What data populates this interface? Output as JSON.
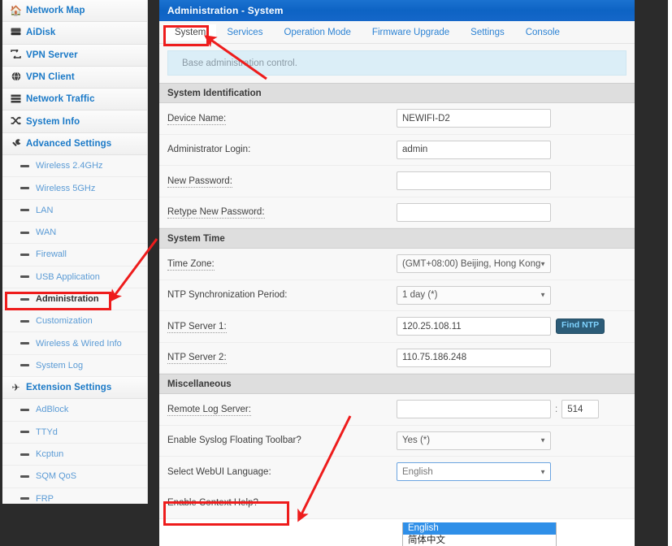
{
  "sidebar": {
    "items": [
      {
        "label": "Network Map",
        "icon": "home-icon",
        "type": "top"
      },
      {
        "label": "AiDisk",
        "icon": "hard-drive-icon",
        "type": "top"
      },
      {
        "label": "VPN Server",
        "icon": "exchange-icon",
        "type": "top"
      },
      {
        "label": "VPN Client",
        "icon": "globe-icon",
        "type": "top"
      },
      {
        "label": "Network Traffic",
        "icon": "server-icon",
        "type": "top"
      },
      {
        "label": "System Info",
        "icon": "shuffle-icon",
        "type": "top"
      },
      {
        "label": "Advanced Settings",
        "icon": "wrench-icon",
        "type": "top"
      },
      {
        "label": "Wireless 2.4GHz",
        "icon": "dash-icon",
        "type": "sub"
      },
      {
        "label": "Wireless 5GHz",
        "icon": "dash-icon",
        "type": "sub"
      },
      {
        "label": "LAN",
        "icon": "dash-icon",
        "type": "sub"
      },
      {
        "label": "WAN",
        "icon": "dash-icon",
        "type": "sub"
      },
      {
        "label": "Firewall",
        "icon": "dash-icon",
        "type": "sub"
      },
      {
        "label": "USB Application",
        "icon": "dash-icon",
        "type": "sub"
      },
      {
        "label": "Administration",
        "icon": "dash-icon",
        "type": "sub",
        "selected": true
      },
      {
        "label": "Customization",
        "icon": "dash-icon",
        "type": "sub"
      },
      {
        "label": "Wireless & Wired Info",
        "icon": "dash-icon",
        "type": "sub"
      },
      {
        "label": "System Log",
        "icon": "dash-icon",
        "type": "sub"
      },
      {
        "label": "Extension Settings",
        "icon": "plane-icon",
        "type": "top"
      },
      {
        "label": "AdBlock",
        "icon": "dash-icon",
        "type": "sub"
      },
      {
        "label": "TTYd",
        "icon": "dash-icon",
        "type": "sub"
      },
      {
        "label": "Kcptun",
        "icon": "dash-icon",
        "type": "sub"
      },
      {
        "label": "SQM QoS",
        "icon": "dash-icon",
        "type": "sub"
      },
      {
        "label": "FRP",
        "icon": "dash-icon",
        "type": "sub"
      }
    ]
  },
  "header": {
    "title": "Administration - System"
  },
  "tabs": [
    {
      "label": "System",
      "active": true
    },
    {
      "label": "Services",
      "active": false
    },
    {
      "label": "Operation Mode",
      "active": false
    },
    {
      "label": "Firmware Upgrade",
      "active": false
    },
    {
      "label": "Settings",
      "active": false
    },
    {
      "label": "Console",
      "active": false
    }
  ],
  "infobar": {
    "text": "Base administration control."
  },
  "sections": {
    "system_identification": {
      "title": "System Identification",
      "rows": {
        "device_name": {
          "label": "Device Name:",
          "value": "NEWIFI-D2"
        },
        "admin_login": {
          "label": "Administrator Login:",
          "value": "admin"
        },
        "new_password": {
          "label": "New Password:",
          "value": ""
        },
        "retype_password": {
          "label": "Retype New Password:",
          "value": ""
        }
      }
    },
    "system_time": {
      "title": "System Time",
      "rows": {
        "time_zone": {
          "label": "Time Zone:",
          "value": "(GMT+08:00) Beijing, Hong Kong"
        },
        "ntp_period": {
          "label": "NTP Synchronization Period:",
          "value": "1 day (*)"
        },
        "ntp_server1": {
          "label": "NTP Server 1:",
          "value": "120.25.108.11",
          "button": "Find NTP"
        },
        "ntp_server2": {
          "label": "NTP Server 2:",
          "value": "110.75.186.248"
        }
      }
    },
    "miscellaneous": {
      "title": "Miscellaneous",
      "rows": {
        "remote_log": {
          "label": "Remote Log Server:",
          "value": "",
          "separator": ":",
          "port": "514"
        },
        "syslog_toolbar": {
          "label": "Enable Syslog Floating Toolbar?",
          "value": "Yes (*)"
        },
        "webui_language": {
          "label": "Select WebUI Language:",
          "value": "English",
          "options": [
            {
              "label": "English",
              "selected": true
            },
            {
              "label": "简体中文",
              "selected": false
            }
          ]
        },
        "context_help": {
          "label": "Enable Context Help?"
        }
      }
    }
  },
  "colors": {
    "titlebar_blue": "#0d63c4",
    "link_blue": "#2d83d4",
    "sub_link_blue": "#5b9bd5",
    "annotation_red": "#ee1c1c",
    "dropdown_highlight": "#2f8fe8",
    "infobar_bg": "#dbeef7",
    "section_bg": "#dedede",
    "findntp_bg": "#2c5c78",
    "findntp_text": "#7fd3ff"
  },
  "annotations": {
    "boxes": [
      {
        "name": "administration-highlight"
      },
      {
        "name": "system-tab-highlight"
      },
      {
        "name": "webui-language-highlight"
      }
    ],
    "arrows": [
      {
        "name": "arrow-to-administration"
      },
      {
        "name": "arrow-to-system-tab"
      },
      {
        "name": "arrow-to-webui-language"
      }
    ]
  }
}
